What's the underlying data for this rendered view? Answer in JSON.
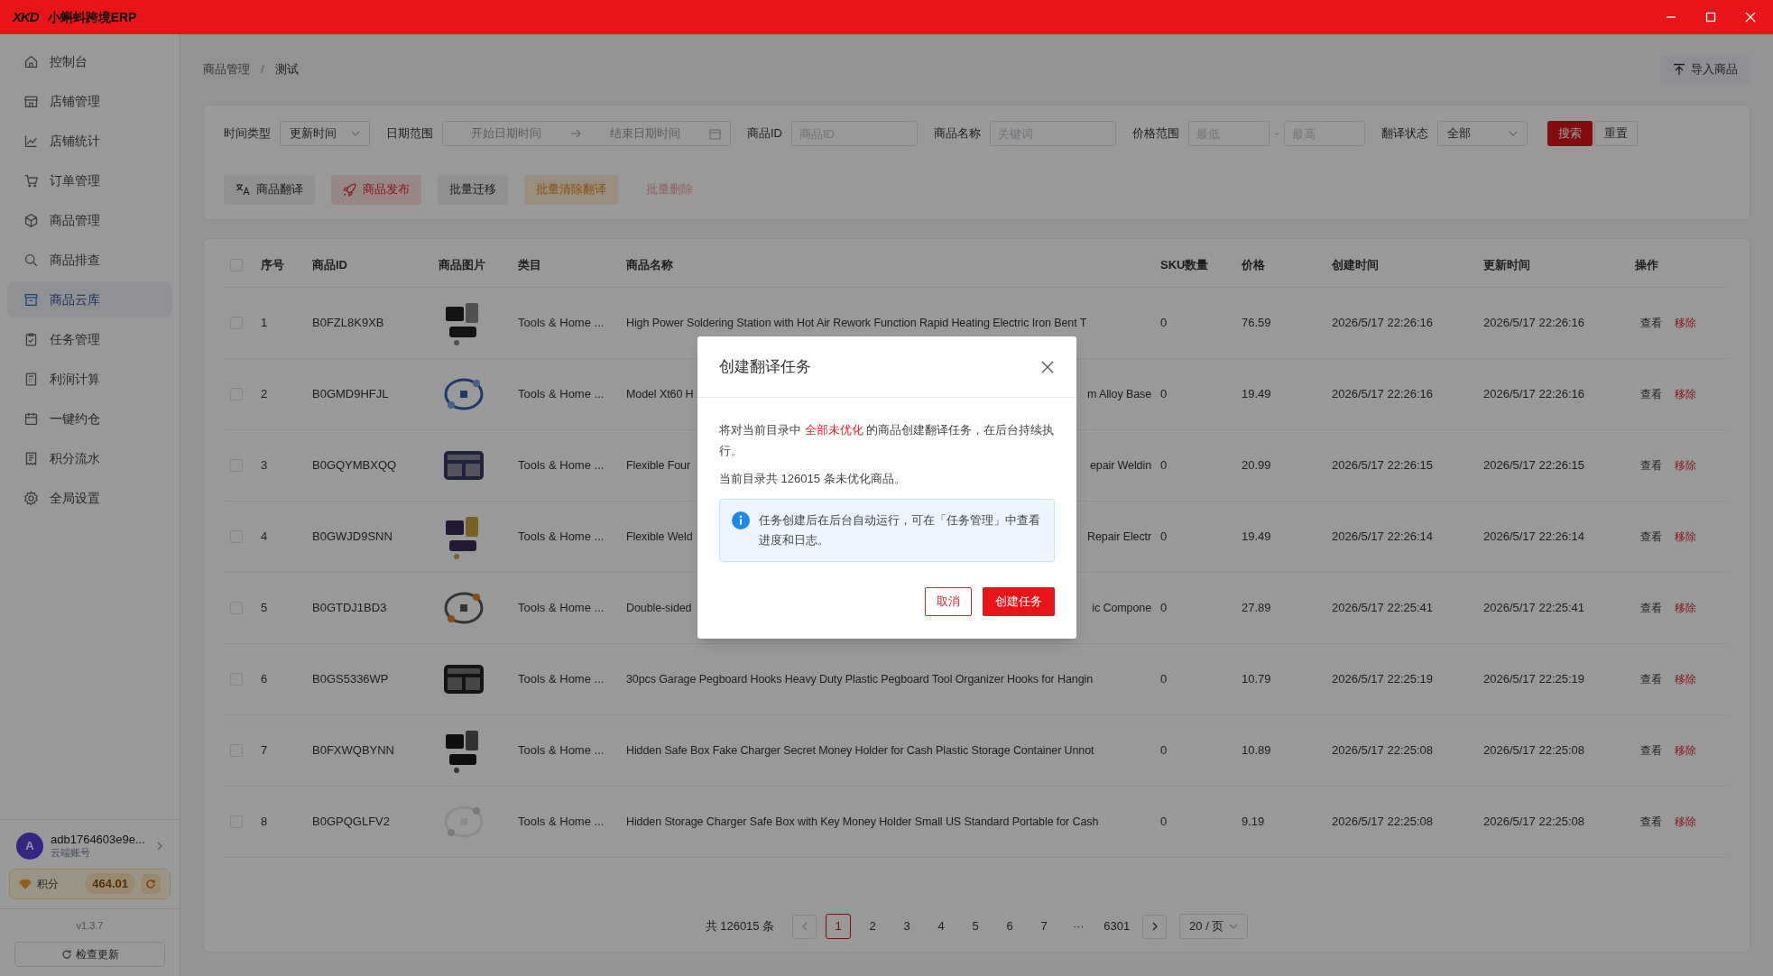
{
  "app": {
    "logo": "XKD",
    "title": "小蝌蚪跨境ERP"
  },
  "sidebar": {
    "items": [
      {
        "label": "控制台",
        "selected": false
      },
      {
        "label": "店铺管理",
        "selected": false
      },
      {
        "label": "店铺统计",
        "selected": false
      },
      {
        "label": "订单管理",
        "selected": false
      },
      {
        "label": "商品管理",
        "selected": false
      },
      {
        "label": "商品排查",
        "selected": false
      },
      {
        "label": "商品云库",
        "selected": true
      },
      {
        "label": "任务管理",
        "selected": false
      },
      {
        "label": "利润计算",
        "selected": false
      },
      {
        "label": "一键约仓",
        "selected": false
      },
      {
        "label": "积分流水",
        "selected": false
      },
      {
        "label": "全局设置",
        "selected": false
      }
    ],
    "user": {
      "avatar": "A",
      "name": "adb1764603e9e...",
      "subtitle": "云端账号"
    },
    "points": {
      "label": "积分",
      "value": "464.01"
    },
    "version": "v1.3.7",
    "update_button": "检查更新"
  },
  "breadcrumb": {
    "items": [
      "商品管理",
      "测试"
    ],
    "separator": "/"
  },
  "import_button": "导入商品",
  "filters": [
    {
      "kind": "select",
      "label": "时间类型",
      "value": "更新时间"
    },
    {
      "kind": "daterange",
      "label": "日期范围",
      "start_placeholder": "开始日期时间",
      "end_placeholder": "结束日期时间"
    },
    {
      "kind": "input",
      "label": "商品ID",
      "placeholder": "商品ID"
    },
    {
      "kind": "input",
      "label": "商品名称",
      "placeholder": "关键词"
    },
    {
      "kind": "range",
      "label": "价格范围",
      "min_placeholder": "最低",
      "separator": "-",
      "max_placeholder": "最高"
    },
    {
      "kind": "select",
      "label": "翻译状态",
      "value": "全部"
    }
  ],
  "search_button": "搜索",
  "reset_button": "重置",
  "actions": [
    {
      "label": "商品翻译",
      "kind": "translate"
    },
    {
      "label": "商品发布",
      "kind": "publish"
    },
    {
      "label": "批量迁移",
      "kind": "plain"
    },
    {
      "label": "批量清除翻译",
      "kind": "warning"
    },
    {
      "label": "批量删除",
      "kind": "disabled"
    }
  ],
  "table": {
    "header_checked": false,
    "columns": [
      "序号",
      "商品ID",
      "商品图片",
      "类目",
      "商品名称",
      "SKU数量",
      "价格",
      "创建时间",
      "更新时间",
      "操作"
    ],
    "rows": [
      {
        "checked": false,
        "index": "1",
        "id": "B0FZL8K9XB",
        "category": "Tools & Home ...",
        "name": "High Power Soldering Station with Hot Air Rework Function Rapid Heating Electric Iron Bent T",
        "sku": "0",
        "price": "76.59",
        "created": "2026/5/17 22:26:16",
        "updated": "2026/5/17 22:26:16",
        "actions": [
          "查看",
          "移除"
        ]
      },
      {
        "checked": false,
        "index": "2",
        "id": "B0GMD9HFJL",
        "category": "Tools & Home ...",
        "name": "Model Xt60 H",
        "name_end": "m Alloy Base",
        "sku": "0",
        "price": "19.49",
        "created": "2026/5/17 22:26:16",
        "updated": "2026/5/17 22:26:16",
        "actions": [
          "查看",
          "移除"
        ]
      },
      {
        "checked": false,
        "index": "3",
        "id": "B0GQYMBXQQ",
        "category": "Tools & Home ...",
        "name": "Flexible Four",
        "name_end": "epair Weldin",
        "sku": "0",
        "price": "20.99",
        "created": "2026/5/17 22:26:15",
        "updated": "2026/5/17 22:26:15",
        "actions": [
          "查看",
          "移除"
        ]
      },
      {
        "checked": false,
        "index": "4",
        "id": "B0GWJD9SNN",
        "category": "Tools & Home ...",
        "name": "Flexible Weld",
        "name_end": "Repair Electr",
        "sku": "0",
        "price": "19.49",
        "created": "2026/5/17 22:26:14",
        "updated": "2026/5/17 22:26:14",
        "actions": [
          "查看",
          "移除"
        ]
      },
      {
        "checked": false,
        "index": "5",
        "id": "B0GTDJ1BD3",
        "category": "Tools & Home ...",
        "name": "Double-sided",
        "name_end": "ic Compone",
        "sku": "0",
        "price": "27.89",
        "created": "2026/5/17 22:25:41",
        "updated": "2026/5/17 22:25:41",
        "actions": [
          "查看",
          "移除"
        ]
      },
      {
        "checked": false,
        "index": "6",
        "id": "B0GS5336WP",
        "category": "Tools & Home ...",
        "name": "30pcs Garage Pegboard Hooks Heavy Duty Plastic Pegboard Tool Organizer Hooks for Hangin",
        "sku": "0",
        "price": "10.79",
        "created": "2026/5/17 22:25:19",
        "updated": "2026/5/17 22:25:19",
        "actions": [
          "查看",
          "移除"
        ]
      },
      {
        "checked": false,
        "index": "7",
        "id": "B0FXWQBYNN",
        "category": "Tools & Home ...",
        "name": "Hidden Safe Box Fake Charger Secret Money Holder for Cash Plastic Storage Container Unnot",
        "sku": "0",
        "price": "10.89",
        "created": "2026/5/17 22:25:08",
        "updated": "2026/5/17 22:25:08",
        "actions": [
          "查看",
          "移除"
        ]
      },
      {
        "checked": false,
        "index": "8",
        "id": "B0GPQGLFV2",
        "category": "Tools & Home ...",
        "name": "Hidden Storage Charger Safe Box with Key Money Holder Small US Standard Portable for Cash",
        "sku": "0",
        "price": "9.19",
        "created": "2026/5/17 22:25:08",
        "updated": "2026/5/17 22:25:08",
        "actions": [
          "查看",
          "移除"
        ]
      }
    ]
  },
  "pagination": {
    "total": "共 126015 条",
    "pages": [
      {
        "label": "1",
        "selected": true
      },
      {
        "label": "2",
        "selected": false
      },
      {
        "label": "3",
        "selected": false
      },
      {
        "label": "4",
        "selected": false
      },
      {
        "label": "5",
        "selected": false
      },
      {
        "label": "6",
        "selected": false
      },
      {
        "label": "7",
        "selected": false
      },
      {
        "label": "···",
        "selected": false
      },
      {
        "label": "6301",
        "selected": false
      }
    ],
    "page_size": "20 / 页"
  },
  "dialog": {
    "title": "创建翻译任务",
    "message": [
      {
        "text": "将对当前目录中 ",
        "highlight": false
      },
      {
        "text": "全部未优化",
        "highlight": true
      },
      {
        "text": " 的商品创建翻译任务，在后台持续执行。",
        "highlight": false
      }
    ],
    "count_text": "当前目录共 126015 条未优化商品。",
    "info": "任务创建后在后台自动运行，可在「任务管理」中查看进度和日志。",
    "buttons": [
      {
        "label": "取消",
        "kind": "secondary"
      },
      {
        "label": "创建任务",
        "kind": "primary"
      }
    ]
  }
}
